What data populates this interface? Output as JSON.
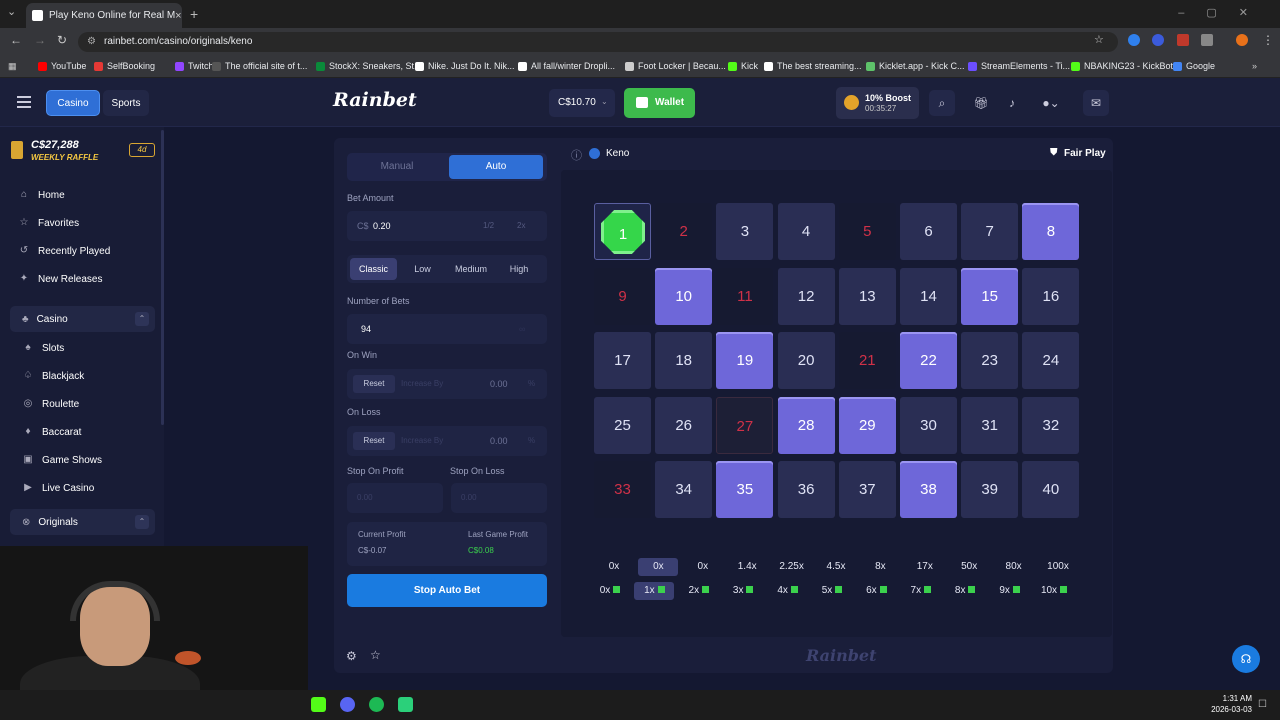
{
  "browser": {
    "tab_title": "Play Keno Online for Real M",
    "url": "rainbet.com/casino/originals/keno",
    "bookmarks": [
      {
        "label": "YouTube",
        "color": "#ff0000"
      },
      {
        "label": "SelfBooking",
        "color": "#e53935"
      },
      {
        "label": "Twitch",
        "color": "#9146ff"
      },
      {
        "label": "The official site of t...",
        "color": "#555555"
      },
      {
        "label": "StockX: Sneakers, St...",
        "color": "#0a8a3a"
      },
      {
        "label": "Nike. Just Do It. Nik...",
        "color": "#ffffff"
      },
      {
        "label": "All fall/winter Dropli...",
        "color": "#ffffff"
      },
      {
        "label": "Foot Locker | Becau...",
        "color": "#cccccc"
      },
      {
        "label": "Kick",
        "color": "#53fc18"
      },
      {
        "label": "The best streaming...",
        "color": "#ffffff"
      },
      {
        "label": "Kicklet.app - Kick C...",
        "color": "#5ec26a"
      },
      {
        "label": "StreamElements - Ti...",
        "color": "#6b4eff"
      },
      {
        "label": "NBAKING23 - KickBot",
        "color": "#53fc18"
      },
      {
        "label": "Google",
        "color": "#4285f4"
      }
    ]
  },
  "header": {
    "tab_casino": "Casino",
    "tab_sports": "Sports",
    "logo": "Rainbet",
    "balance": "C$10.70",
    "wallet": "Wallet",
    "boost_title": "10% Boost",
    "boost_timer": "00:35:27"
  },
  "sidebar": {
    "raffle_amount": "C$27,288",
    "raffle_label": "WEEKLY RAFFLE",
    "raffle_days": "4d",
    "top_items": [
      "Home",
      "Favorites",
      "Recently Played",
      "New Releases"
    ],
    "casino_group": "Casino",
    "casino_items": [
      "Slots",
      "Blackjack",
      "Roulette",
      "Baccarat",
      "Game Shows",
      "Live Casino"
    ],
    "originals_group": "Originals"
  },
  "controls": {
    "mode_manual": "Manual",
    "mode_auto": "Auto",
    "bet_amount_label": "Bet Amount",
    "bet_currency": "C$",
    "bet_amount": "0.20",
    "half": "1/2",
    "double": "2x",
    "risk": [
      "Classic",
      "Low",
      "Medium",
      "High"
    ],
    "num_bets_label": "Number of Bets",
    "num_bets": "94",
    "on_win_label": "On Win",
    "on_loss_label": "On Loss",
    "reset": "Reset",
    "increase_by": "Increase By",
    "win_value": "0.00",
    "loss_value": "0.00",
    "percent": "%",
    "stop_profit_label": "Stop On Profit",
    "stop_loss_label": "Stop On Loss",
    "stop_profit_placeholder": "0.00",
    "stop_loss_placeholder": "0.00",
    "current_profit_label": "Current Profit",
    "current_profit": "C$-0.07",
    "last_profit_label": "Last Game Profit",
    "last_profit": "C$0.08",
    "stop_button": "Stop Auto Bet"
  },
  "game": {
    "title": "Keno",
    "fair_play": "Fair Play",
    "cells": [
      {
        "n": "1",
        "state": "gem"
      },
      {
        "n": "2",
        "state": "miss"
      },
      {
        "n": "3",
        "state": "normal"
      },
      {
        "n": "4",
        "state": "normal"
      },
      {
        "n": "5",
        "state": "miss"
      },
      {
        "n": "6",
        "state": "normal"
      },
      {
        "n": "7",
        "state": "normal"
      },
      {
        "n": "8",
        "state": "pick"
      },
      {
        "n": "9",
        "state": "miss"
      },
      {
        "n": "10",
        "state": "pick"
      },
      {
        "n": "11",
        "state": "miss"
      },
      {
        "n": "12",
        "state": "normal"
      },
      {
        "n": "13",
        "state": "normal"
      },
      {
        "n": "14",
        "state": "normal"
      },
      {
        "n": "15",
        "state": "pick"
      },
      {
        "n": "16",
        "state": "normal"
      },
      {
        "n": "17",
        "state": "normal"
      },
      {
        "n": "18",
        "state": "normal"
      },
      {
        "n": "19",
        "state": "pick"
      },
      {
        "n": "20",
        "state": "normal"
      },
      {
        "n": "21",
        "state": "miss"
      },
      {
        "n": "22",
        "state": "pick"
      },
      {
        "n": "23",
        "state": "normal"
      },
      {
        "n": "24",
        "state": "normal"
      },
      {
        "n": "25",
        "state": "normal"
      },
      {
        "n": "26",
        "state": "normal"
      },
      {
        "n": "27",
        "state": "missbox"
      },
      {
        "n": "28",
        "state": "pick"
      },
      {
        "n": "29",
        "state": "pick"
      },
      {
        "n": "30",
        "state": "normal"
      },
      {
        "n": "31",
        "state": "normal"
      },
      {
        "n": "32",
        "state": "normal"
      },
      {
        "n": "33",
        "state": "miss"
      },
      {
        "n": "34",
        "state": "normal"
      },
      {
        "n": "35",
        "state": "pick"
      },
      {
        "n": "36",
        "state": "normal"
      },
      {
        "n": "37",
        "state": "normal"
      },
      {
        "n": "38",
        "state": "pick"
      },
      {
        "n": "39",
        "state": "normal"
      },
      {
        "n": "40",
        "state": "normal"
      }
    ],
    "multipliers": [
      "0x",
      "0x",
      "0x",
      "1.4x",
      "2.25x",
      "4.5x",
      "8x",
      "17x",
      "50x",
      "80x",
      "100x"
    ],
    "hit_counts": [
      "0x",
      "1x",
      "2x",
      "3x",
      "4x",
      "5x",
      "6x",
      "7x",
      "8x",
      "9x",
      "10x"
    ],
    "selected_index": 1,
    "footer_logo": "Rainbet"
  },
  "taskbar": {
    "time": "1:31 AM",
    "date": "2026-03-03"
  }
}
